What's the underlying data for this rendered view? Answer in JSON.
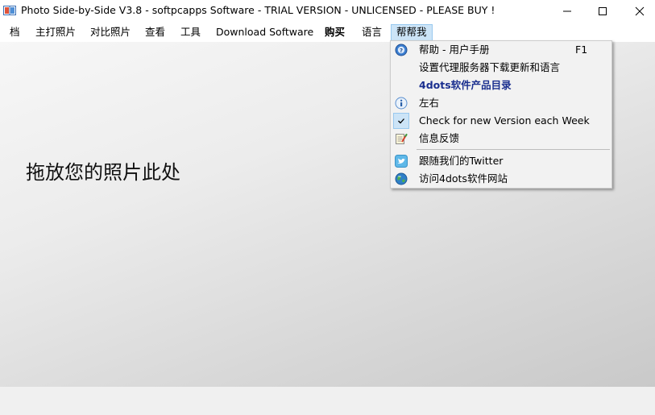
{
  "window": {
    "title": "Photo Side-by-Side V3.8 - softpcapps Software - TRIAL VERSION - UNLICENSED - PLEASE BUY !",
    "icon": "photo-side-by-side-app-icon",
    "controls": {
      "minimize": "minimize-icon",
      "maximize": "maximize-icon",
      "close": "close-icon"
    }
  },
  "menubar": {
    "items": [
      {
        "label": "档"
      },
      {
        "label": "主打照片"
      },
      {
        "label": "对比照片"
      },
      {
        "label": "查看"
      },
      {
        "label": "工具"
      },
      {
        "label": "Download Software"
      },
      {
        "label": "购买"
      },
      {
        "label": "语言"
      },
      {
        "label": "帮帮我"
      }
    ],
    "active_index": 8
  },
  "main": {
    "drop_hint": "拖放您的照片此处"
  },
  "help_menu": {
    "items": [
      {
        "label": "帮助 - 用户手册",
        "shortcut": "F1",
        "icon": "help-icon"
      },
      {
        "label": "设置代理服务器下载更新和语言",
        "icon": ""
      },
      {
        "label": "4dots软件产品目录",
        "icon": "",
        "style": "bold-blue"
      },
      {
        "label": "左右",
        "icon": "info-icon"
      },
      {
        "label": "Check for new Version each Week",
        "icon": "check-icon",
        "checked": true
      },
      {
        "label": "信息反馈",
        "icon": "feedback-icon"
      },
      {
        "label": "跟随我们的Twitter",
        "icon": "twitter-icon"
      },
      {
        "label": "访问4dots软件网站",
        "icon": "globe-icon"
      }
    ]
  },
  "colors": {
    "menu_highlight": "#cce4f7",
    "menu_highlight_border": "#99c9ef",
    "catalog_text": "#1a2f8f"
  }
}
